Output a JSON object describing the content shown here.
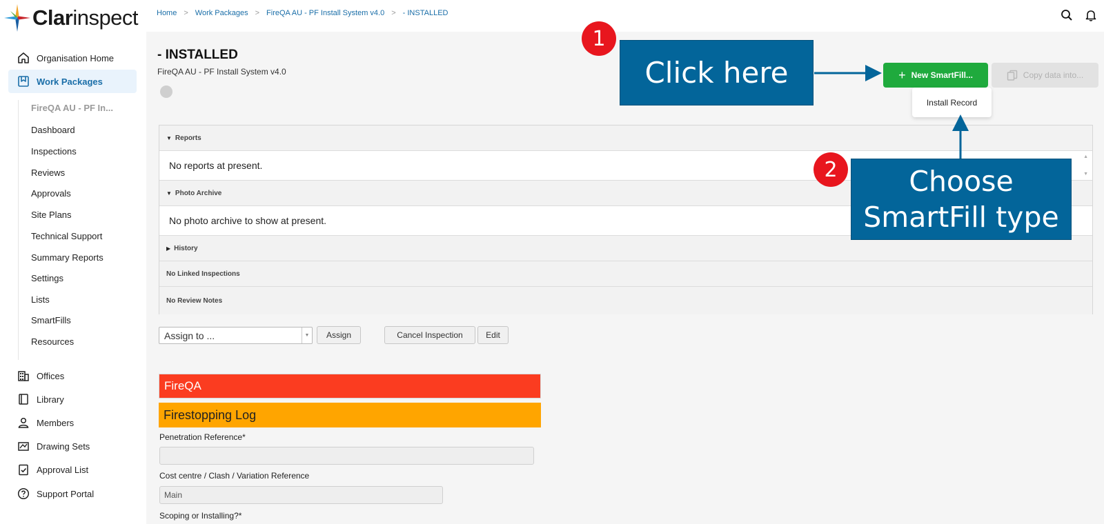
{
  "brand": {
    "logo_bold": "Clar",
    "logo_regular": "inspect"
  },
  "breadcrumbs": [
    "Home",
    "Work Packages",
    "FireQA AU - PF Install System v4.0",
    "- INSTALLED"
  ],
  "sidebar": {
    "items_top": [
      {
        "label": "Organisation Home",
        "icon": "home-icon"
      },
      {
        "label": "Work Packages",
        "icon": "work-packages-icon",
        "active": true
      }
    ],
    "sub_items": [
      "FireQA AU - PF In...",
      "Dashboard",
      "Inspections",
      "Reviews",
      "Approvals",
      "Site Plans",
      "Technical Support",
      "Summary Reports",
      "Settings",
      "Lists",
      "SmartFills",
      "Resources"
    ],
    "items_bottom": [
      {
        "label": "Offices",
        "icon": "building-icon"
      },
      {
        "label": "Library",
        "icon": "book-icon"
      },
      {
        "label": "Members",
        "icon": "person-icon"
      },
      {
        "label": "Drawing Sets",
        "icon": "drawing-icon"
      },
      {
        "label": "Approval List",
        "icon": "checklist-icon"
      },
      {
        "label": "Support Portal",
        "icon": "help-icon"
      }
    ]
  },
  "page": {
    "title": "- INSTALLED",
    "subtitle": "FireQA AU - PF Install System v4.0"
  },
  "actions": {
    "new_smartfill": "New SmartFill...",
    "copy_data": "Copy data into...",
    "dropdown_option": "Install Record"
  },
  "panel": {
    "reports_head": "Reports",
    "reports_body": "No reports at present.",
    "photo_head": "Photo Archive",
    "photo_body": "No photo archive to show at present.",
    "history_head": "History",
    "linked_head": "No Linked Inspections",
    "review_head": "No Review Notes"
  },
  "assign": {
    "select_value": "Assign to ...",
    "assign_btn": "Assign",
    "cancel_btn": "Cancel Inspection",
    "edit_btn": "Edit"
  },
  "form": {
    "bar1": "FireQA",
    "bar2": "Firestopping Log",
    "label_penetration": "Penetration Reference*",
    "label_cost": "Cost centre / Clash / Variation Reference",
    "cost_value": "Main",
    "label_scoping": "Scoping or Installing?*"
  },
  "annotations": {
    "step1_number": "1",
    "step1_text": "Click here",
    "step2_number": "2",
    "step2_line1": "Choose",
    "step2_line2": "SmartFill type"
  },
  "colors": {
    "accent_blue": "#1a6ea8",
    "green": "#1faa3d",
    "red_bar": "#fb3c20",
    "orange_bar": "#ffa500",
    "callout": "#03659a",
    "badge": "#e8161e"
  }
}
